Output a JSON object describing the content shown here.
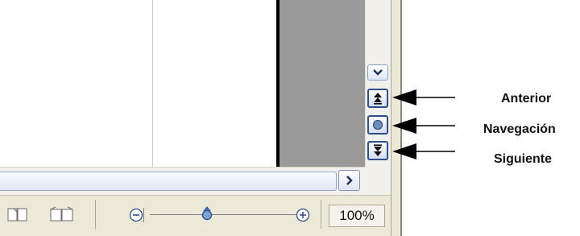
{
  "vertical_scrollbar": {
    "scroll_down_icon": "chevron-down-icon",
    "previous_icon": "double-up-arrow-icon",
    "navigation_icon": "navigation-circle-icon",
    "next_icon": "double-down-arrow-icon"
  },
  "horizontal_scrollbar": {
    "scroll_right_icon": "chevron-right-icon"
  },
  "status_bar": {
    "view_layout_icons": [
      "book-view-icon",
      "two-page-view-icon"
    ],
    "zoom_out_icon": "minus-circle-icon",
    "zoom_in_icon": "plus-circle-icon",
    "zoom_level": 100,
    "zoom_label": "100%"
  },
  "annotations": {
    "previous_label": "Anterior",
    "navigation_label": "Navegación",
    "next_label": "Siguiente"
  },
  "colors": {
    "button_border": "#2f4f8a",
    "frame": "#ece9d8",
    "gray_area": "#9a9a9a"
  }
}
